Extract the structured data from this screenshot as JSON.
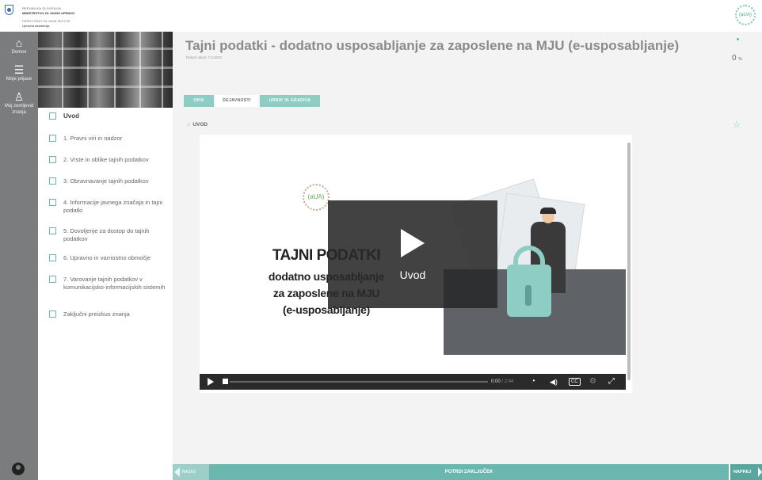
{
  "header": {
    "org_line1": "REPUBLIKA SLOVENIJA",
    "org_line2": "MINISTRSTVO ZA JAVNO UPRAVO",
    "org_line3": "DIREKTORAT ZA JAVNI SEKTOR",
    "org_line4": "Upravna akademija",
    "right_logo_text": "(aUA)"
  },
  "nav": {
    "items": [
      {
        "icon": "home-icon",
        "label": "Domov"
      },
      {
        "icon": "list-icon",
        "label": "Moje prijave"
      },
      {
        "icon": "medal-icon",
        "label": "Moj zemljevid znanja"
      }
    ]
  },
  "course": {
    "title": "Tajni podatki - dodatno usposabljanje za zaposlene na MJU (e-usposabljanje)",
    "date": "Datum vpisa: 7.3.2022",
    "progress_value": "0",
    "progress_unit": "%"
  },
  "chapters": [
    "Uvod",
    "1. Pravni viri in nadzor",
    "2. Vrste in oblike tajnih podatkov",
    "3. Obravnavanje tajnih podatkov",
    "4. Informacije javnega značaja in tajni podatki",
    "5. Dovoljenje za dostop do tajnih podatkov",
    "6. Upravno in varnostno območje",
    "7. Varovanje tajnih podatkov v komunikacijsko-informacijskih sistemih",
    "Zaključni preizkus znanja"
  ],
  "tabs": [
    "OPIS",
    "DEJAVNOSTI",
    "URNIK IN GRADIVA"
  ],
  "section": {
    "grip": "::",
    "title": "UVOD"
  },
  "video": {
    "logo_text": "(aUA)",
    "title": "TAJNI PODATKI",
    "sub1": "dodatno usposabljanje",
    "sub2": "za zaposlene na MJU",
    "sub3": "(e-usposabljanje)",
    "overlay_label": "Uvod",
    "time_current": "0:00",
    "time_total": "2:44",
    "cc_label": "CC"
  },
  "footer": {
    "prev": "NAZAJ",
    "center": "POTRDI ZAKLJUČEK",
    "next": "NAPREJ"
  },
  "colors": {
    "accent": "#6bb6ae",
    "nav": "#7a7c7e"
  }
}
